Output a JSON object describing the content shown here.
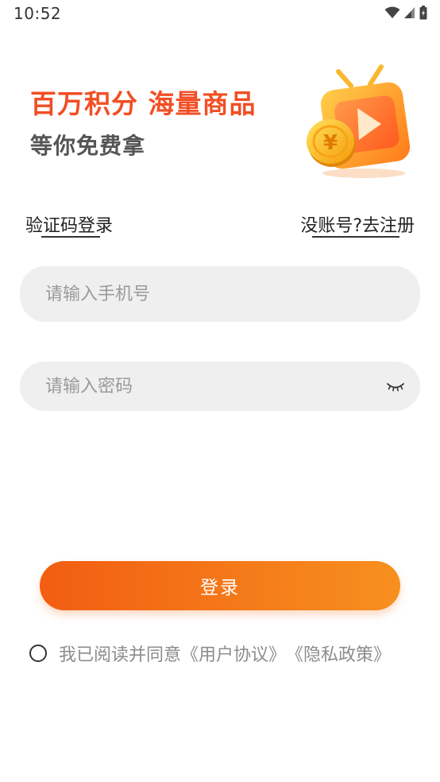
{
  "status_bar": {
    "time": "10:52",
    "icons": [
      "wifi-icon",
      "signal-icon",
      "battery-icon"
    ]
  },
  "hero": {
    "title": "百万积分 海量商品",
    "subtitle": "等你免费拿",
    "title_color": "#f24e24",
    "illustration": "coin-tv-illustration"
  },
  "links": {
    "sms_login": "验证码登录",
    "register": "没账号?去注册"
  },
  "form": {
    "phone_placeholder": "请输入手机号",
    "phone_value": "",
    "password_placeholder": "请输入密码",
    "password_value": "",
    "password_toggle_icon": "eye-closed-icon"
  },
  "login_button": {
    "label": "登录",
    "gradient": [
      "#f25d12",
      "#f7901f"
    ]
  },
  "agreement": {
    "prefix": "我已阅读并同意",
    "user_agreement": "《用户协议》",
    "privacy_policy": "《隐私政策》",
    "checked": false
  }
}
